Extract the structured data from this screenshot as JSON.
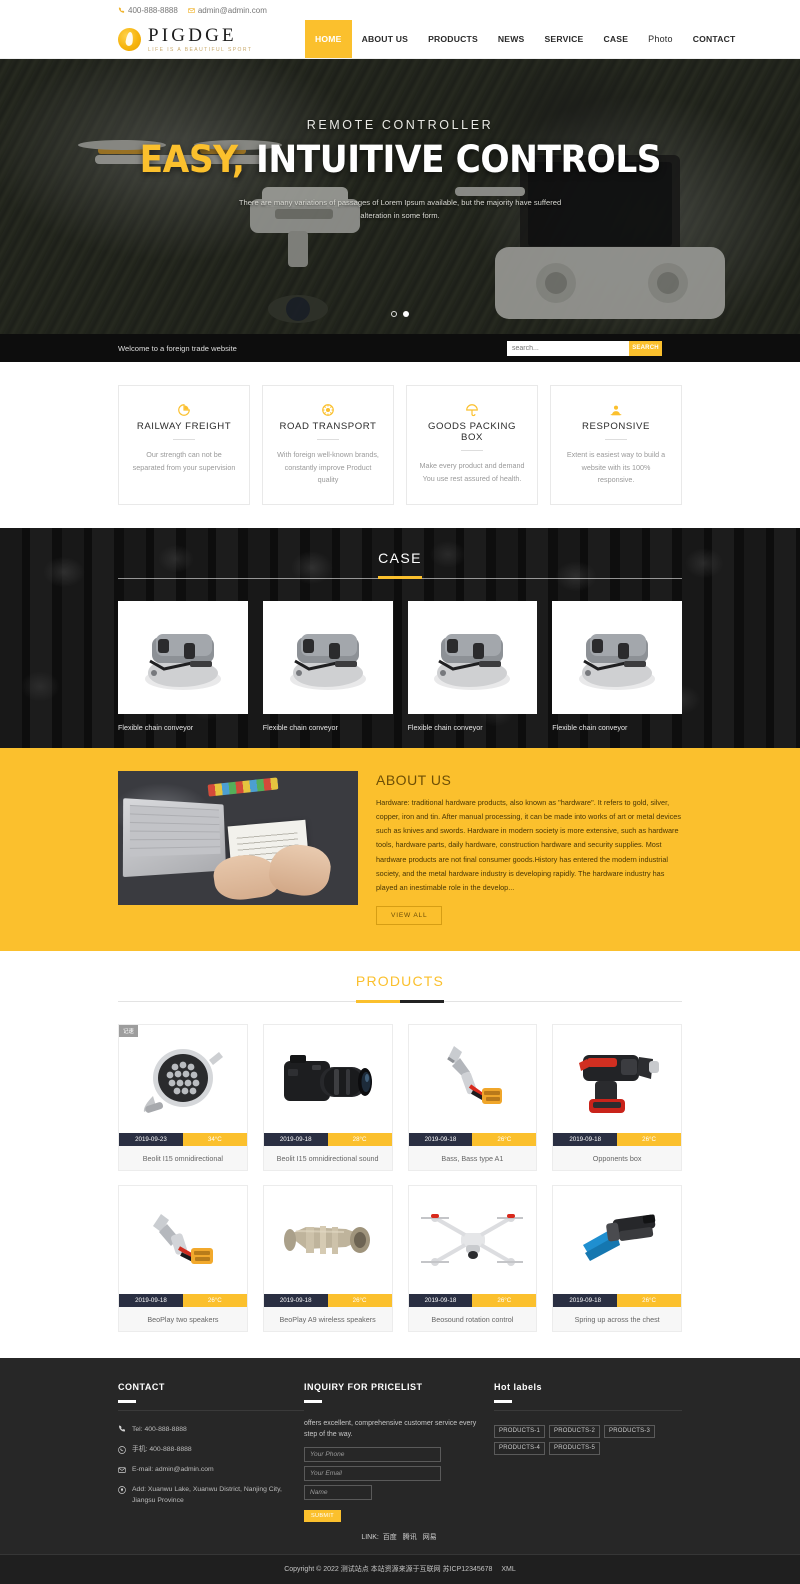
{
  "topbar": {
    "phone": "400-888-8888",
    "email": "admin@admin.com"
  },
  "header": {
    "brand_name": "PIGDGE",
    "brand_tagline": "LIFE IS A BEAUTIFUL SPORT",
    "nav": [
      {
        "label": "HOME",
        "active": true
      },
      {
        "label": "ABOUT US",
        "active": false
      },
      {
        "label": "PRODUCTS",
        "active": false
      },
      {
        "label": "NEWS",
        "active": false
      },
      {
        "label": "SERVICE",
        "active": false
      },
      {
        "label": "CASE",
        "active": false
      },
      {
        "label": "Photo",
        "active": false
      },
      {
        "label": "CONTACT",
        "active": false
      }
    ]
  },
  "hero": {
    "subtitle": "REMOTE CONTROLLER",
    "title_highlight": "EASY,",
    "title_rest": "INTUITIVE CONTROLS",
    "description": "There are many variations of passages of Lorem Ipsum available, but the majority have suffered alteration in some form.",
    "slides": 2,
    "active_slide": 2
  },
  "strip": {
    "welcome": "Welcome to a foreign trade website",
    "search_placeholder": "search...",
    "search_value": "",
    "search_button": "SEARCH"
  },
  "features": [
    {
      "icon": "railway-freight-icon",
      "title": "RAILWAY FREIGHT",
      "desc": "Our strength can not be separated from your supervision"
    },
    {
      "icon": "road-transport-icon",
      "title": "ROAD TRANSPORT",
      "desc": "With foreign well-known brands, constantly improve Product quality"
    },
    {
      "icon": "goods-packing-box-icon",
      "title": "GOODS PACKING BOX",
      "desc": "Make every product and demand You use rest assured of health."
    },
    {
      "icon": "responsive-icon",
      "title": "RESPONSIVE",
      "desc": "Extent is easiest way to build a website with its 100% responsive."
    }
  ],
  "case": {
    "title": "CASE",
    "items": [
      {
        "name": "Flexible chain conveyor"
      },
      {
        "name": "Flexible chain conveyor"
      },
      {
        "name": "Flexible chain conveyor"
      },
      {
        "name": "Flexible chain conveyor"
      }
    ]
  },
  "about": {
    "title": "ABOUT US",
    "body": "Hardware: traditional hardware products, also known as \"hardware\". It refers to gold, silver, copper, iron and tin. After manual processing, it can be made into works of art or metal devices such as knives and swords. Hardware in modern society is more extensive, such as hardware tools, hardware parts, daily hardware, construction hardware and security supplies. Most hardware products are not final consumer goods.History has entered the modern industrial society, and the metal hardware industry is developing rapidly. The hardware industry has played an inestimable role in the develop...",
    "view_all": "VIEW ALL"
  },
  "products": {
    "title": "PRODUCTS",
    "items": [
      {
        "badge": "记速",
        "date": "2019-09-23",
        "temp": "34°C",
        "name": "Beolit I15 omnidirectional",
        "art": "floodlight"
      },
      {
        "badge": "",
        "date": "2019-09-18",
        "temp": "28°C",
        "name": "Beolit I15 omnidirectional sound",
        "art": "camera"
      },
      {
        "badge": "",
        "date": "2019-09-18",
        "temp": "26°C",
        "name": "Bass, Bass type A1",
        "art": "crimper"
      },
      {
        "badge": "",
        "date": "2019-09-18",
        "temp": "26°C",
        "name": "Opponents box",
        "art": "rebar-tool"
      },
      {
        "badge": "",
        "date": "2019-09-18",
        "temp": "26°C",
        "name": "BeoPlay two speakers",
        "art": "connector"
      },
      {
        "badge": "",
        "date": "2019-09-18",
        "temp": "26°C",
        "name": "BeoPlay A9 wireless speakers",
        "art": "coupling"
      },
      {
        "badge": "",
        "date": "2019-09-18",
        "temp": "26°C",
        "name": "Beosound rotation control",
        "art": "drone"
      },
      {
        "badge": "",
        "date": "2019-09-18",
        "temp": "26°C",
        "name": "Spring up across the chest",
        "art": "pliers"
      }
    ]
  },
  "footer": {
    "contact_heading": "CONTACT",
    "contact_items": [
      {
        "icon": "phone-icon",
        "text": "Tel:  400-888-8888"
      },
      {
        "icon": "whatsapp-icon",
        "text": "手机:  400-888-8888"
      },
      {
        "icon": "envelope-icon",
        "text": "E-mail: admin@admin.com"
      },
      {
        "icon": "map-pin-icon",
        "text": "Add:  Xuanwu Lake, Xuanwu District, Nanjing City, Jiangsu Province"
      }
    ],
    "inquiry_heading": "INQUIRY FOR PRICELIST",
    "inquiry_desc": "offers excellent, comprehensive customer service every step of the way.",
    "inquiry_fields": [
      {
        "placeholder": "Your Phone",
        "value": "",
        "size": "full"
      },
      {
        "placeholder": "Your Email",
        "value": "",
        "size": "full"
      },
      {
        "placeholder": "Name",
        "value": "",
        "size": "half"
      }
    ],
    "submit_label": "SUBMIT",
    "labels_heading": "Hot labels",
    "labels": [
      "PRODUCTS-1",
      "PRODUCTS-2",
      "PRODUCTS-3",
      "PRODUCTS-4",
      "PRODUCTS-5"
    ],
    "link_prefix": "LINK:",
    "links": [
      "百度",
      "腾讯",
      "网易"
    ],
    "copyright": "Copyright © 2022 测试站点 本站资源来源于互联网 苏ICP12345678",
    "xml_label": "XML"
  },
  "colors": {
    "accent": "#fbc02d",
    "dark": "#0d0d0d",
    "footer_bg": "#272727",
    "meta_date_bg": "#2a2f42"
  }
}
